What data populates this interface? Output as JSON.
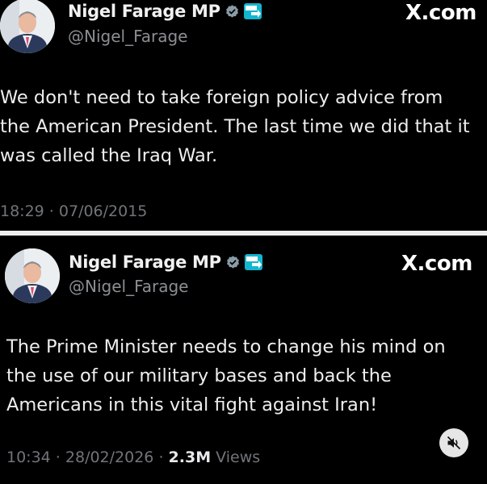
{
  "posts": [
    {
      "author": {
        "name": "Nigel Farage MP",
        "handle": "@Nigel_Farage"
      },
      "brand": "X.com",
      "text_lines": [
        "We don't need to take foreign policy advice from",
        "the American President. The last time we did that it",
        "was called the Iraq War."
      ],
      "time": "18:29",
      "date": "07/06/2015"
    },
    {
      "author": {
        "name": "Nigel Farage MP",
        "handle": "@Nigel_Farage"
      },
      "brand": "X.com",
      "text_lines": [
        "The Prime Minister needs to change his mind on",
        "the use of our military bases and back the",
        "Americans in this vital fight against Iran!"
      ],
      "time": "10:34",
      "date": "28/02/2026",
      "views_count": "2.3M",
      "views_label": "Views"
    }
  ],
  "icons": {
    "verified": "verified-badge-icon",
    "reform": "reform-uk-logo-icon",
    "mute": "speaker-muted-icon"
  },
  "colors": {
    "background": "#000000",
    "text": "#e7e9ea",
    "muted_text": "#70757a",
    "divider": "#ededed",
    "verified_badge": "#8a9ba8",
    "reform_blue": "#12b6cf"
  }
}
